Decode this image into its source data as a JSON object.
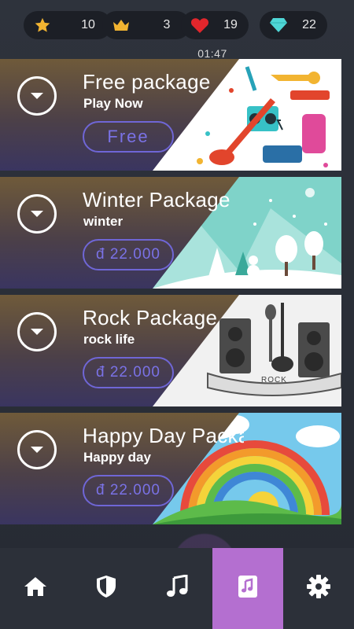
{
  "status": {
    "stars": "10",
    "crowns": "3",
    "hearts": "19",
    "diamonds": "22",
    "timer": "01:47"
  },
  "colors": {
    "star": "#f2b431",
    "crown": "#f2b431",
    "heart": "#e1262c",
    "diamond": "#4fd6d6",
    "price_border": "#6f66d6",
    "active_nav": "#b46fd0"
  },
  "packages": [
    {
      "title": "Free package",
      "subtitle": "Play Now",
      "button": "Free",
      "art": "music-instruments-art"
    },
    {
      "title": "Winter Package",
      "subtitle": "winter",
      "button": "đ 22.000",
      "art": "winter-landscape-art"
    },
    {
      "title": "Rock Package",
      "subtitle": "rock life",
      "button": "đ 22.000",
      "art": "rock-speakers-guitar-art"
    },
    {
      "title": "Happy Day Package",
      "subtitle": "Happy day",
      "button": "đ 22.000",
      "art": "rainbow-art"
    }
  ],
  "rock_art_label": "ROCK",
  "nav": [
    {
      "name": "home",
      "icon": "home-icon"
    },
    {
      "name": "shield",
      "icon": "shield-icon"
    },
    {
      "name": "music",
      "icon": "music-note-icon"
    },
    {
      "name": "songs",
      "icon": "music-file-icon",
      "active": true
    },
    {
      "name": "settings",
      "icon": "gear-icon"
    }
  ]
}
